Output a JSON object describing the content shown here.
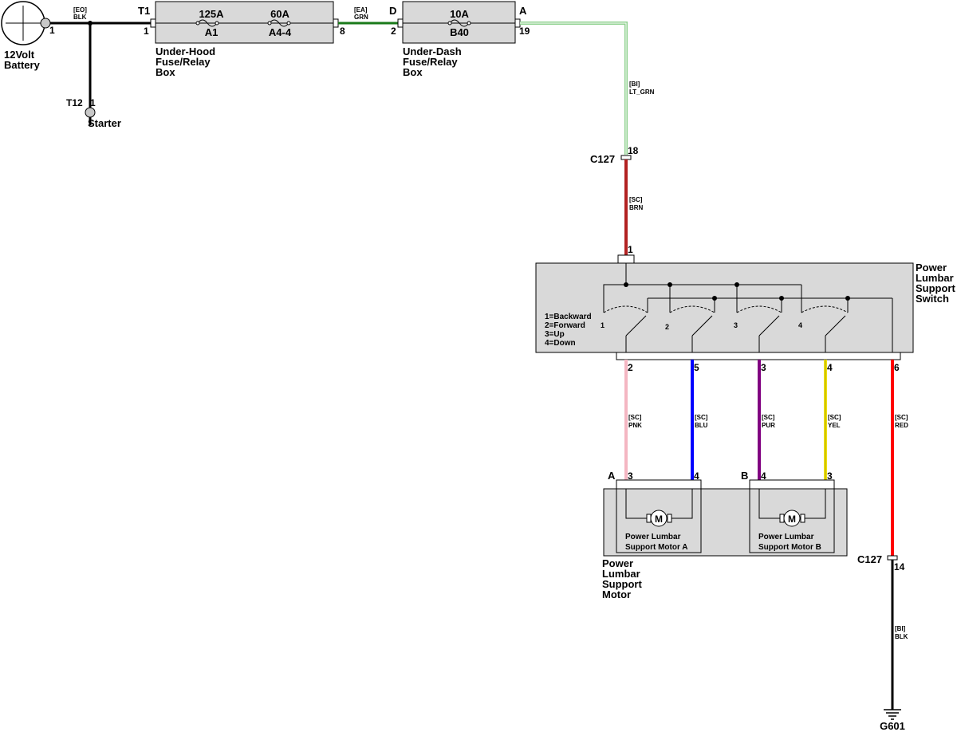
{
  "battery": {
    "name_line1": "12Volt",
    "name_line2": "Battery",
    "pin": "1"
  },
  "starter": {
    "ref": "T12",
    "pin": "1",
    "name": "Starter"
  },
  "wires": {
    "battery_feed": {
      "circuit": "[EO]",
      "color_name": "BLK",
      "hex": "#000000"
    },
    "fuse_link": {
      "circuit": "[EA]",
      "color_name": "GRN",
      "hex": "#1a7a1a"
    },
    "lt_grn": {
      "circuit": "[BI]",
      "color_name": "LT_GRN",
      "hex": "#8fd18f"
    },
    "brn": {
      "circuit": "[SC]",
      "color_name": "BRN",
      "hex": "#b22222"
    },
    "pnk": {
      "circuit": "[SC]",
      "color_name": "PNK",
      "hex": "#f4b6c2"
    },
    "blu": {
      "circuit": "[SC]",
      "color_name": "BLU",
      "hex": "#0000ff"
    },
    "pur": {
      "circuit": "[SC]",
      "color_name": "PUR",
      "hex": "#800080"
    },
    "yel": {
      "circuit": "[SC]",
      "color_name": "YEL",
      "hex": "#f0e000"
    },
    "red": {
      "circuit": "[SC]",
      "color_name": "RED",
      "hex": "#ff0000"
    },
    "gnd": {
      "circuit": "[BI]",
      "color_name": "BLK",
      "hex": "#000000"
    }
  },
  "underhood": {
    "conn_in": "T1",
    "pin_in": "1",
    "pin_out": "8",
    "fuse1_rating": "125A",
    "fuse1_id": "A1",
    "fuse2_rating": "60A",
    "fuse2_id": "A4-4",
    "name_line1": "Under-Hood",
    "name_line2": "Fuse/Relay",
    "name_line3": "Box"
  },
  "underdash": {
    "conn_in": "D",
    "pin_in": "2",
    "conn_out": "A",
    "pin_out": "19",
    "fuse_rating": "10A",
    "fuse_id": "B40",
    "name_line1": "Under-Dash",
    "name_line2": "Fuse/Relay",
    "name_line3": "Box"
  },
  "c127_top": {
    "ref": "C127",
    "pin": "18"
  },
  "c127_bottom": {
    "ref": "C127",
    "pin": "14"
  },
  "switch": {
    "name_line1": "Power",
    "name_line2": "Lumbar",
    "name_line3": "Support",
    "name_line4": "Switch",
    "pin_in": "1",
    "legend1": "1=Backward",
    "legend2": "2=Forward",
    "legend3": "3=Up",
    "legend4": "4=Down",
    "pos1": "1",
    "pos2": "2",
    "pos3": "3",
    "pos4": "4",
    "out_pins": [
      "2",
      "5",
      "3",
      "4",
      "6"
    ]
  },
  "motor_assembly": {
    "name_line1": "Power",
    "name_line2": "Lumbar",
    "name_line3": "Support",
    "name_line4": "Motor",
    "motor_a": {
      "conn": "A",
      "pin_left": "3",
      "pin_right": "4",
      "label1": "Power Lumbar",
      "label2": "Support Motor A",
      "symbol": "M"
    },
    "motor_b": {
      "conn": "B",
      "pin_left": "4",
      "pin_right": "3",
      "label1": "Power Lumbar",
      "label2": "Support Motor B",
      "symbol": "M"
    }
  },
  "ground": {
    "ref": "G601"
  }
}
